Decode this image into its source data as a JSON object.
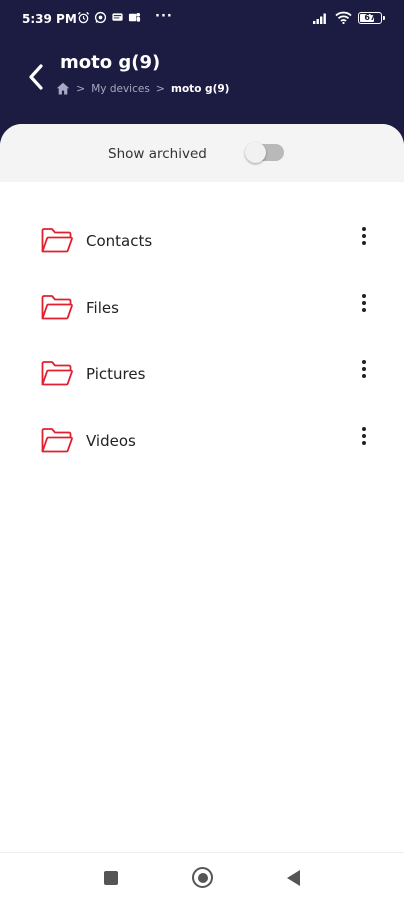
{
  "status": {
    "time": "5:39 PM",
    "more": "···",
    "battery": "67",
    "icons": [
      "alarm-icon",
      "whatsapp-icon",
      "message-icon",
      "teams-icon",
      "signal-icon",
      "wifi-icon",
      "battery-icon"
    ]
  },
  "header": {
    "title": "moto g(9)",
    "breadcrumb": {
      "home_icon": "home-icon",
      "sep": ">",
      "parent": "My devices",
      "current": "moto g(9)"
    }
  },
  "archived": {
    "label": "Show archived",
    "enabled": false
  },
  "folders": [
    {
      "label": "Contacts"
    },
    {
      "label": "Files"
    },
    {
      "label": "Pictures"
    },
    {
      "label": "Videos"
    }
  ],
  "colors": {
    "header_bg": "#1c1b42",
    "folder_icon": "#e0202f"
  }
}
